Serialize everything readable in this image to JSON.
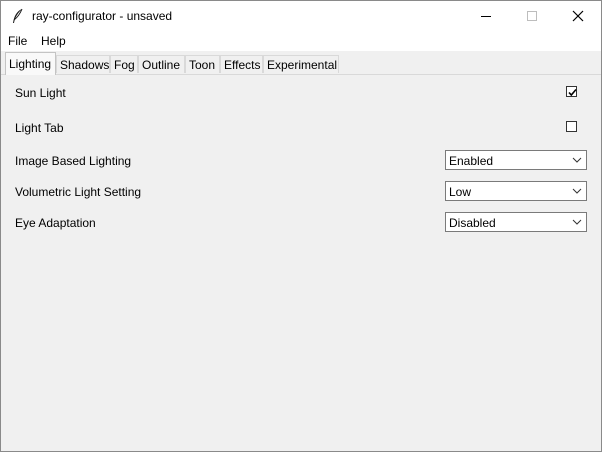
{
  "window": {
    "title": "ray-configurator - unsaved",
    "icon": "feather-icon",
    "controls": [
      "minimize",
      "maximize",
      "close"
    ]
  },
  "menu": {
    "file": "File",
    "help": "Help"
  },
  "tabs": [
    {
      "label": "Lighting",
      "active": true
    },
    {
      "label": "Shadows",
      "active": false
    },
    {
      "label": "Fog",
      "active": false
    },
    {
      "label": "Outline",
      "active": false
    },
    {
      "label": "Toon",
      "active": false
    },
    {
      "label": "Effects",
      "active": false
    },
    {
      "label": "Experimental",
      "active": false
    }
  ],
  "settings": {
    "sun_light": {
      "label": "Sun Light",
      "checked": true
    },
    "light_tab": {
      "label": "Light Tab",
      "checked": false
    },
    "image_based_lighting": {
      "label": "Image Based Lighting",
      "value": "Enabled"
    },
    "volumetric_light": {
      "label": "Volumetric Light Setting",
      "value": "Low"
    },
    "eye_adaptation": {
      "label": "Eye Adaptation",
      "value": "Disabled"
    }
  },
  "colors": {
    "window_bg": "#f0f0f0",
    "titlebar_bg": "#ffffff",
    "border": "#7a7a7a"
  }
}
